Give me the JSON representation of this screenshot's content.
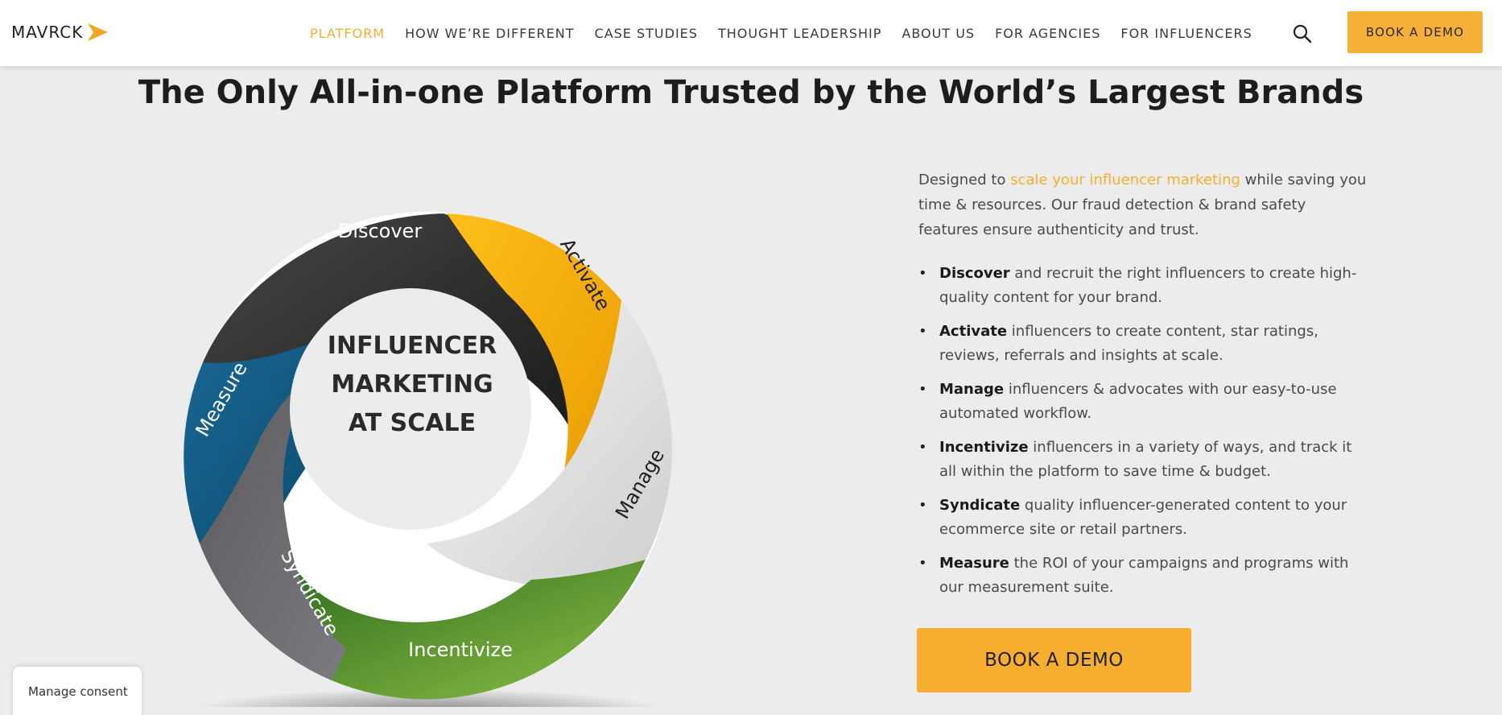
{
  "header": {
    "logo_text": "MAVRCK",
    "nav": [
      {
        "label": "PLATFORM",
        "active": true
      },
      {
        "label": "HOW WE’RE DIFFERENT",
        "active": false
      },
      {
        "label": "CASE STUDIES",
        "active": false
      },
      {
        "label": "THOUGHT LEADERSHIP",
        "active": false
      },
      {
        "label": "ABOUT US",
        "active": false
      },
      {
        "label": "FOR AGENCIES",
        "active": false
      },
      {
        "label": "FOR INFLUENCERS",
        "active": false
      }
    ],
    "search_icon": "search-icon",
    "cta_label": "BOOK A DEMO"
  },
  "page": {
    "title": "The Only All-in-one Platform Trusted by the World’s Largest Brands"
  },
  "wheel": {
    "center_lines": [
      "INFLUENCER",
      "MARKETING",
      "AT SCALE"
    ],
    "segments": [
      {
        "label": "Discover",
        "color": "#2f2f2f"
      },
      {
        "label": "Activate",
        "color": "#f6ab00"
      },
      {
        "label": "Manage",
        "color": "#e8e8e8"
      },
      {
        "label": "Incentivize",
        "color": "#80b43c"
      },
      {
        "label": "Syndicate",
        "color": "#6a6a6e"
      },
      {
        "label": "Measure",
        "color": "#0d5b86"
      }
    ]
  },
  "intro": {
    "before": "Designed to ",
    "highlight": "scale your influencer marketing",
    "after": " while saving you time & resources. Our fraud detection & brand safety features ensure authenticity and trust."
  },
  "bullets": [
    {
      "bold": "Discover",
      "text": " and recruit the right influencers to create high-quality content for your brand."
    },
    {
      "bold": "Activate",
      "text": " influencers to create content, star ratings, reviews, referrals and insights at scale."
    },
    {
      "bold": "Manage",
      "text": " influencers & advocates with our easy-to-use automated workflow."
    },
    {
      "bold": "Incentivize",
      "text": " influencers in a variety of ways, and track it all within the platform to save time & budget."
    },
    {
      "bold": "Syndicate",
      "text": " quality influencer-generated content to your ecommerce site or retail partners."
    },
    {
      "bold": "Measure",
      "text": " the ROI of your campaigns and programs with our measurement suite."
    }
  ],
  "main_cta": "BOOK A DEMO",
  "consent": "Manage consent",
  "colors": {
    "accent": "#f7b13a",
    "highlight_text": "#f5b02e"
  }
}
